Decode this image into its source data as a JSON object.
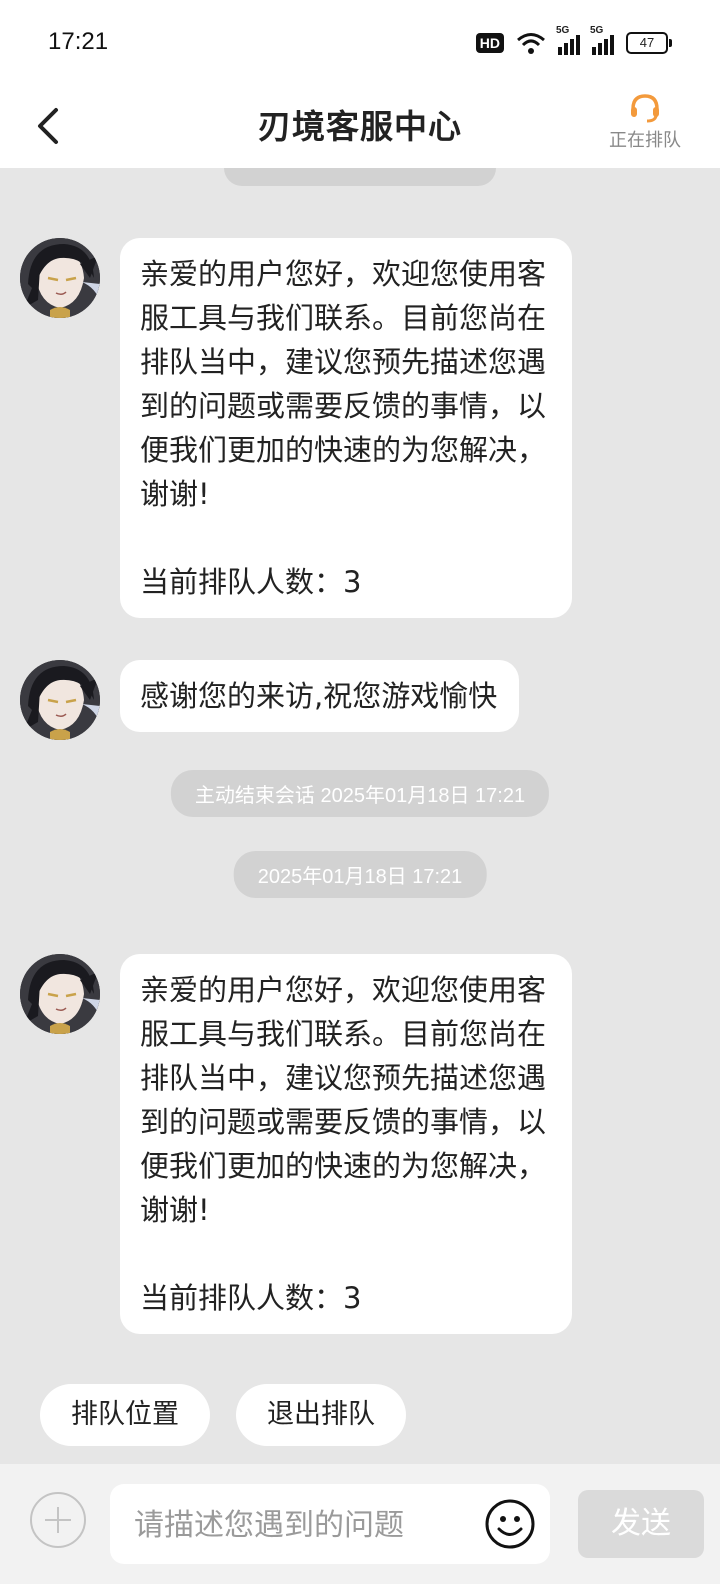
{
  "status_bar": {
    "time": "17:21",
    "network_labels": [
      "5G",
      "5G"
    ],
    "hd_label": "HD",
    "battery": "47"
  },
  "header": {
    "title": "刃境客服中心",
    "queue_label": "正在排队",
    "accent_color": "#f39a3c"
  },
  "messages": [
    {
      "sender": "agent",
      "text": "亲爱的用户您好，欢迎您使用客服工具与我们联系。目前您尚在排队当中，建议您预先描述您遇到的问题或需要反馈的事情，以便我们更加的快速的为您解决，谢谢!",
      "queue_line": "当前排队人数：3"
    },
    {
      "sender": "agent",
      "text": "感谢您的来访,祝您游戏愉快"
    },
    {
      "sender": "system",
      "text": "主动结束会话 2025年01月18日 17:21"
    },
    {
      "sender": "system",
      "text": "2025年01月18日 17:21"
    },
    {
      "sender": "agent",
      "text": "亲爱的用户您好，欢迎您使用客服工具与我们联系。目前您尚在排队当中，建议您预先描述您遇到的问题或需要反馈的事情，以便我们更加的快速的为您解决，谢谢!",
      "queue_line": "当前排队人数：3"
    }
  ],
  "quick_actions": [
    "排队位置",
    "退出排队"
  ],
  "composer": {
    "placeholder": "请描述您遇到的问题",
    "value": "",
    "send_label": "发送"
  }
}
